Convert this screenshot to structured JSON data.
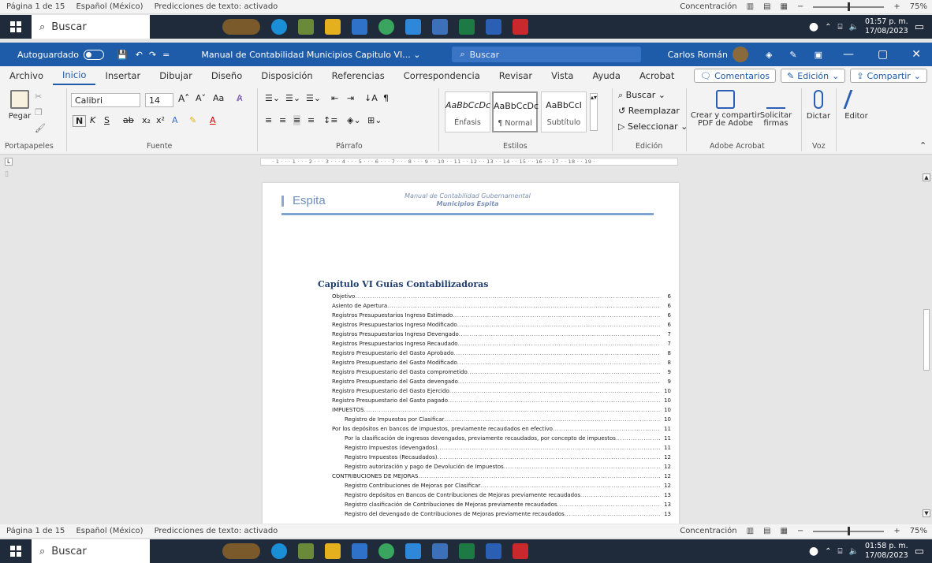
{
  "statusbar": {
    "page": "Página 1 de 15",
    "language": "Español (México)",
    "predictions": "Predicciones de texto: activado",
    "focus": "Concentración",
    "zoom": "75%"
  },
  "taskbar": {
    "search": "Buscar",
    "time_top": "01:57 p. m.",
    "date_top": "17/08/2023",
    "time_bottom": "01:58 p. m.",
    "date_bottom": "17/08/2023"
  },
  "titlebar": {
    "autosave": "Autoguardado",
    "doc_title": "Manual de Contabilidad Municipios Capitulo VI... ⌄",
    "search_placeholder": "Buscar",
    "user": "Carlos Román"
  },
  "menu": {
    "tabs": [
      "Archivo",
      "Inicio",
      "Insertar",
      "Dibujar",
      "Diseño",
      "Disposición",
      "Referencias",
      "Correspondencia",
      "Revisar",
      "Vista",
      "Ayuda",
      "Acrobat"
    ],
    "comments": "Comentarios",
    "edit": "Edición",
    "share": "Compartir"
  },
  "ribbon": {
    "paste": "Pegar",
    "font_name": "Calibri",
    "font_size": "14",
    "styles": [
      {
        "sample": "AaBbCcDc",
        "name": "Énfasis"
      },
      {
        "sample": "AaBbCcDc",
        "name": "¶ Normal"
      },
      {
        "sample": "AaBbCcI",
        "name": "Subtítulo"
      }
    ],
    "find": "Buscar",
    "replace": "Reemplazar",
    "select": "Seleccionar",
    "create_pdf": "Crear y compartir PDF de Adobe",
    "request_signatures": "Solicitar firmas",
    "dictate": "Dictar",
    "editor": "Editor",
    "groups": {
      "clipboard": "Portapapeles",
      "font": "Fuente",
      "paragraph": "Párrafo",
      "styles": "Estilos",
      "editing": "Edición",
      "acrobat": "Adobe Acrobat",
      "voice": "Voz"
    }
  },
  "ruler": "· 1 · · · 1 · · · 2 · · · 3 · · · 4 · · · 5 · · · 6 · · · 7 · · · 8 · · · 9 · · 10 · · 11 · · 12 · · 13 · · 14 · · 15 · · 16 · · 17 · · 18 · · 19 ·",
  "document": {
    "brand": "Espita",
    "header_line1": "Manual de Contabilidad Gubernamental",
    "header_line2": "Municipios Espita",
    "toc_title": "Capítulo VI Guías Contabilizadoras",
    "toc": [
      {
        "text": "Objetivo",
        "page": "6",
        "level": 1
      },
      {
        "text": "Asiento de Apertura",
        "page": "6",
        "level": 1
      },
      {
        "text": "Registros Presupuestarios Ingreso Estimado",
        "page": "6",
        "level": 1
      },
      {
        "text": "Registros Presupuestarios Ingreso Modificado",
        "page": "6",
        "level": 1
      },
      {
        "text": "Registros Presupuestarios Ingreso Devengado",
        "page": "7",
        "level": 1
      },
      {
        "text": "Registros Presupuestarios Ingreso Recaudado",
        "page": "7",
        "level": 1
      },
      {
        "text": "Registro Presupuestario del Gasto Aprobado",
        "page": "8",
        "level": 1
      },
      {
        "text": "Registro Presupuestario del Gasto Modificado",
        "page": "8",
        "level": 1
      },
      {
        "text": "Registro Presupuestario del Gasto comprometido",
        "page": "9",
        "level": 1
      },
      {
        "text": "Registro Presupuestario del Gasto devengado",
        "page": "9",
        "level": 1
      },
      {
        "text": "Registro Presupuestario del Gasto Ejercido",
        "page": "10",
        "level": 1
      },
      {
        "text": "Registro Presupuestario del Gasto pagado",
        "page": "10",
        "level": 1
      },
      {
        "text": "IMPUESTOS",
        "page": "10",
        "level": 1
      },
      {
        "text": "Registro de Impuestos por Clasificar",
        "page": "10",
        "level": 2
      },
      {
        "text": "Por los depósitos en bancos de impuestos, previamente recaudados en efectivo",
        "page": "11",
        "level": 1
      },
      {
        "text": "Por la clasificación de ingresos devengados, previamente recaudados, por concepto de impuestos",
        "page": "11",
        "level": 2
      },
      {
        "text": "Registro Impuestos (devengados)",
        "page": "11",
        "level": 2
      },
      {
        "text": "Registro Impuestos (Recaudados)",
        "page": "12",
        "level": 2
      },
      {
        "text": "Registro autorización y pago de Devolución de Impuestos",
        "page": "12",
        "level": 2
      },
      {
        "text": "CONTRIBUCIONES DE MEJORAS",
        "page": "12",
        "level": 1
      },
      {
        "text": "Registro Contribuciones de Mejoras por Clasificar",
        "page": "12",
        "level": 2
      },
      {
        "text": "Registro depósitos en Bancos de Contribuciones de Mejoras previamente recaudados",
        "page": "13",
        "level": 2
      },
      {
        "text": "Registro clasificación de Contribuciones de Mejoras previamente recaudados",
        "page": "13",
        "level": 2
      },
      {
        "text": "Registro del devengado de Contribuciones de Mejoras previamente recaudados",
        "page": "13",
        "level": 2
      }
    ]
  }
}
